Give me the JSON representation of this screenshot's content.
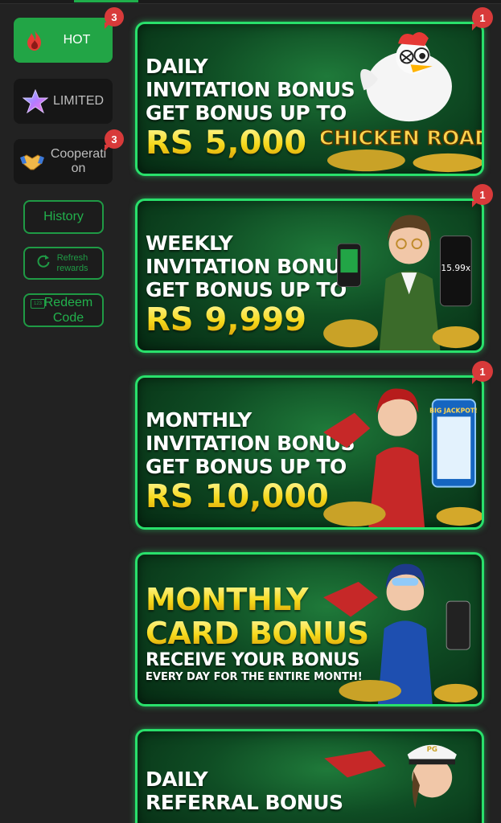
{
  "sidebar": {
    "categories": [
      {
        "label": "HOT",
        "badge": "3",
        "icon": "fire-icon",
        "active": true
      },
      {
        "label": "LIMITED",
        "badge": "",
        "icon": "star-icon",
        "active": false
      },
      {
        "label": "Cooperation",
        "badge": "3",
        "icon": "handshake-icon",
        "active": false
      }
    ],
    "history_label": "History",
    "refresh_label": "Refresh rewards",
    "redeem_label": "Redeem Code",
    "redeem_tag": "123"
  },
  "banners": [
    {
      "line1": "DAILY",
      "line2": "INVITATION BONUS",
      "line3": "GET BONUS UP TO",
      "amount": "RS 5,000",
      "badge": "1",
      "logo": "CHICKEN ROAD"
    },
    {
      "line1": "WEEKLY",
      "line2": "INVITATION BONUS",
      "line3": "GET BONUS UP TO",
      "amount": "RS 9,999",
      "badge": "1",
      "phone_text": "15.99x"
    },
    {
      "line1": "MONTHLY",
      "line2": "INVITATION BONUS",
      "line3": "GET BONUS UP TO",
      "amount": "RS 10,000",
      "badge": "1",
      "phone_text": "BIG JACKPOT!"
    },
    {
      "line1": "MONTHLY",
      "line2": "CARD BONUS",
      "line3": "RECEIVE YOUR BONUS",
      "line4": "EVERY DAY FOR THE ENTIRE MONTH!"
    },
    {
      "line1": "DAILY",
      "line2": "REFERRAL BONUS",
      "cap_text": "PG"
    }
  ],
  "colors": {
    "accent": "#22a546",
    "badge": "#d83a3a",
    "banner_border": "#29e06b",
    "amount": "#f5d81a"
  }
}
